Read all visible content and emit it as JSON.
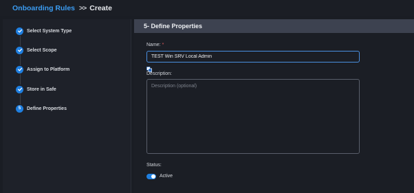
{
  "breadcrumb": {
    "parent": "Onboarding Rules",
    "separator": ">>",
    "current": "Create"
  },
  "steps": [
    {
      "label": "Select System Type",
      "state": "done"
    },
    {
      "label": "Select Scope",
      "state": "done"
    },
    {
      "label": "Assign to Platform",
      "state": "done"
    },
    {
      "label": "Store in Safe",
      "state": "done"
    },
    {
      "label": "Define Properties",
      "state": "active",
      "number": "5"
    }
  ],
  "panel": {
    "title": "5- Define Properties"
  },
  "form": {
    "name_label": "Name:",
    "required_marker": "*",
    "name_value": "TEST Win SRV Local Admin",
    "description_label": "Description:",
    "description_placeholder": "Description (optional)",
    "status_label": "Status:",
    "status_toggle_label": "Active",
    "status_on": true
  },
  "colors": {
    "accent": "#1f7fe0",
    "link": "#3b9cf2",
    "header_bg": "#3d4250",
    "required": "#e25c5c"
  },
  "icons": {
    "step_done": "check-icon",
    "copy": "copy-icon"
  }
}
